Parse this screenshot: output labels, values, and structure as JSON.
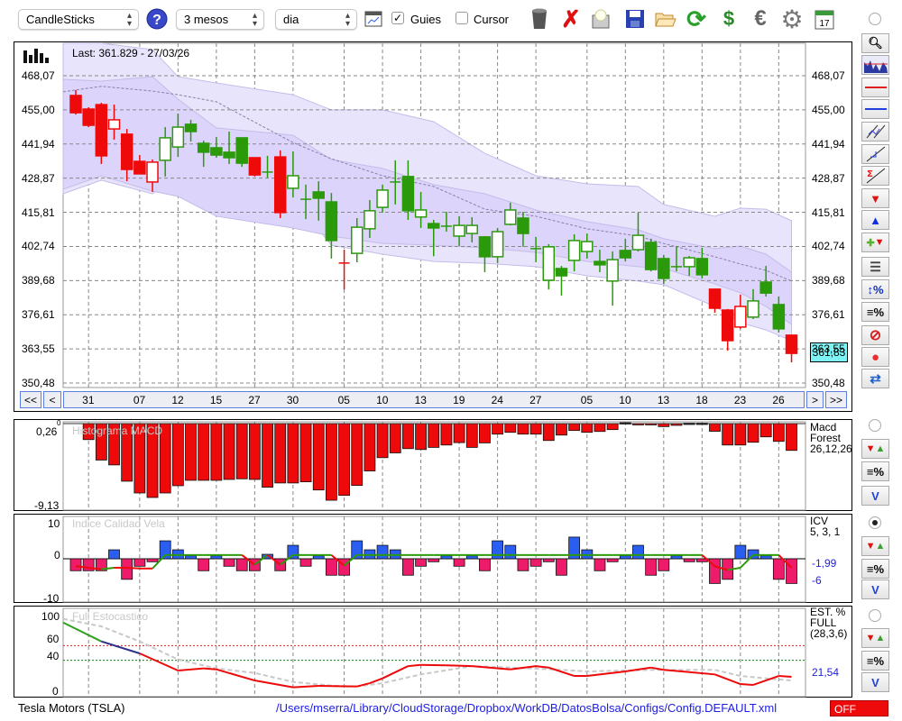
{
  "toolbar": {
    "chart_type": "CandleSticks",
    "period": "3 mesos",
    "interval": "dia",
    "guides_label": "Guies",
    "guides_checked": true,
    "cursor_label": "Cursor",
    "cursor_checked": false,
    "icons": [
      "help-icon",
      "chart-window-icon",
      "trash-icon",
      "delete-icon",
      "print-icon",
      "save-icon",
      "open-folder-icon",
      "refresh-icon",
      "download-icon",
      "euro-icon",
      "gear-icon",
      "calendar-icon"
    ],
    "calendar_day": "17"
  },
  "main_chart": {
    "last_label": "Last: 361.829 - 27/03/26",
    "last_price_box": "361,83",
    "price_ticks": [
      468.07,
      455.0,
      441.94,
      428.87,
      415.81,
      402.74,
      389.68,
      376.61,
      363.55,
      350.48
    ],
    "price_tick_labels": [
      "468,07",
      "455,00",
      "441,94",
      "428,87",
      "415,81",
      "402,74",
      "389,68",
      "376,61",
      "363,55",
      "350,48"
    ],
    "x_labels": [
      "31",
      "07",
      "12",
      "15",
      "27",
      "30",
      "05",
      "10",
      "13",
      "19",
      "24",
      "27",
      "05",
      "10",
      "13",
      "18",
      "23",
      "26"
    ],
    "x_label_candle_index": [
      1,
      5,
      8,
      11,
      14,
      17,
      21,
      24,
      27,
      30,
      33,
      36,
      40,
      43,
      46,
      49,
      52,
      55
    ],
    "nav": {
      "first": "<<",
      "prev": "<",
      "next": ">",
      "last": ">>"
    },
    "colors": {
      "up": "#2a9a0a",
      "down": "#ee0a0a",
      "band_outer": "#e8e4fc",
      "band_inner": "#dcd4fa",
      "cursor_box": "#7ff4f4"
    },
    "candles_ohlc": [
      [
        460.5,
        462.6,
        453.2,
        453.9,
        "r"
      ],
      [
        455.3,
        456.0,
        448.4,
        449.1,
        "r"
      ],
      [
        457.0,
        457.7,
        434.3,
        437.4,
        "r"
      ],
      [
        447.7,
        457.0,
        443.6,
        451.2,
        "r"
      ],
      [
        445.7,
        447.7,
        427.7,
        432.2,
        "r"
      ],
      [
        435.3,
        437.7,
        430.5,
        430.5,
        "r"
      ],
      [
        427.4,
        436.0,
        423.6,
        435.0,
        "r"
      ],
      [
        435.7,
        448.4,
        429.5,
        444.3,
        "g"
      ],
      [
        440.8,
        453.6,
        437.0,
        448.4,
        "g"
      ],
      [
        449.5,
        451.2,
        442.9,
        446.7,
        "g"
      ],
      [
        442.2,
        443.2,
        433.2,
        438.8,
        "g"
      ],
      [
        440.5,
        444.6,
        436.7,
        437.7,
        "g"
      ],
      [
        438.8,
        446.7,
        434.3,
        436.7,
        "g"
      ],
      [
        444.3,
        444.3,
        433.2,
        434.6,
        "g"
      ],
      [
        436.7,
        436.7,
        429.5,
        430.1,
        "r"
      ],
      [
        431.2,
        437.4,
        429.0,
        431.2,
        "g"
      ],
      [
        437.0,
        439.5,
        413.6,
        415.7,
        "r"
      ],
      [
        425.0,
        439.1,
        421.5,
        429.8,
        "g"
      ],
      [
        420.8,
        426.4,
        413.2,
        420.8,
        "g"
      ],
      [
        423.6,
        427.7,
        412.6,
        421.2,
        "g"
      ],
      [
        419.8,
        423.2,
        398.1,
        405.0,
        "g"
      ],
      [
        396.4,
        401.5,
        386.3,
        396.4,
        "r"
      ],
      [
        400.1,
        413.6,
        396.7,
        410.1,
        "g"
      ],
      [
        409.5,
        420.5,
        406.0,
        416.4,
        "g"
      ],
      [
        417.7,
        426.4,
        415.7,
        424.3,
        "g"
      ],
      [
        427.4,
        435.7,
        418.8,
        427.4,
        "g"
      ],
      [
        429.5,
        435.7,
        412.9,
        416.4,
        "g"
      ],
      [
        414.0,
        423.6,
        409.8,
        416.7,
        "g"
      ],
      [
        411.5,
        412.9,
        399.0,
        409.8,
        "g"
      ],
      [
        410.5,
        416.0,
        408.4,
        410.5,
        "g"
      ],
      [
        406.7,
        414.3,
        402.9,
        410.8,
        "g"
      ],
      [
        407.7,
        413.9,
        404.3,
        410.8,
        "g"
      ],
      [
        406.4,
        406.7,
        392.9,
        398.8,
        "g"
      ],
      [
        398.8,
        409.8,
        396.4,
        408.4,
        "g"
      ],
      [
        411.2,
        419.5,
        410.8,
        416.7,
        "g"
      ],
      [
        413.6,
        416.0,
        402.6,
        407.7,
        "g"
      ],
      [
        401.9,
        406.4,
        396.7,
        401.9,
        "g"
      ],
      [
        389.8,
        403.6,
        386.3,
        402.6,
        "g"
      ],
      [
        394.3,
        395.3,
        383.9,
        391.5,
        "g"
      ],
      [
        397.4,
        407.4,
        393.2,
        405.0,
        "g"
      ],
      [
        400.8,
        407.7,
        398.1,
        404.6,
        "g"
      ],
      [
        397.0,
        401.5,
        392.9,
        395.7,
        "g"
      ],
      [
        389.5,
        400.8,
        380.1,
        397.7,
        "g"
      ],
      [
        401.2,
        405.7,
        397.0,
        398.4,
        "g"
      ],
      [
        401.5,
        415.7,
        400.8,
        407.0,
        "g"
      ],
      [
        404.3,
        405.7,
        393.2,
        393.9,
        "g"
      ],
      [
        398.1,
        399.5,
        388.4,
        390.5,
        "g"
      ],
      [
        395.0,
        402.9,
        393.2,
        395.0,
        "g"
      ],
      [
        395.0,
        399.1,
        391.5,
        398.4,
        "g"
      ],
      [
        398.1,
        402.2,
        390.5,
        391.9,
        "g"
      ],
      [
        386.4,
        386.4,
        377.4,
        379.1,
        "r"
      ],
      [
        378.4,
        378.8,
        362.9,
        366.7,
        "r"
      ],
      [
        371.9,
        384.3,
        371.2,
        379.8,
        "r"
      ],
      [
        375.7,
        386.4,
        375.0,
        381.9,
        "g"
      ],
      [
        389.1,
        395.3,
        383.6,
        384.9,
        "g"
      ],
      [
        380.5,
        383.6,
        369.8,
        371.2,
        "g"
      ],
      [
        368.8,
        368.8,
        358.4,
        361.83,
        "r"
      ]
    ],
    "bands": {
      "candle_index": [
        -1,
        2,
        6,
        8,
        11,
        17,
        20,
        24,
        28,
        32,
        36,
        40,
        44,
        46,
        50,
        52,
        54,
        56
      ],
      "outer_upper": [
        480.5,
        480.5,
        478.1,
        467.7,
        465.3,
        460.8,
        455.0,
        455.0,
        450.5,
        438.4,
        429.8,
        426.7,
        425.7,
        418.8,
        414.3,
        417.4,
        417.0,
        412.6
      ],
      "inner_upper": [
        466.7,
        466.0,
        467.7,
        459.1,
        448.1,
        445.3,
        436.0,
        432.6,
        426.4,
        422.9,
        416.7,
        412.2,
        409.1,
        405.7,
        401.9,
        402.9,
        399.8,
        392.9
      ],
      "middle": [
        461.9,
        464.0,
        462.2,
        460.8,
        458.1,
        442.5,
        436.3,
        429.8,
        425.7,
        417.0,
        414.3,
        409.5,
        406.7,
        403.9,
        398.8,
        396.0,
        393.6,
        389.5
      ],
      "inner_lower": [
        424.6,
        429.8,
        423.9,
        421.9,
        414.3,
        409.8,
        406.7,
        403.9,
        403.2,
        402.2,
        400.5,
        397.0,
        395.0,
        394.3,
        388.4,
        385.0,
        379.8,
        372.9
      ],
      "outer_lower": [
        422.9,
        428.1,
        422.9,
        429.8,
        431.5,
        421.2,
        403.2,
        399.8,
        397.0,
        396.3,
        395.0,
        391.5,
        389.5,
        388.1,
        379.8,
        373.6,
        370.8,
        366.7
      ]
    }
  },
  "macd": {
    "title": "Histograma MACD",
    "zero_label": "0",
    "max_label": "0,26",
    "min_label": "-9,13",
    "legend": [
      "Macd",
      "Forest",
      "26,12,26"
    ],
    "first_candle_index": 1,
    "values": [
      -1.81,
      -4.12,
      -4.67,
      -6.51,
      -7.84,
      -8.35,
      -7.84,
      -7.02,
      -6.41,
      -6.41,
      -6.41,
      -6.31,
      -6.24,
      -6.31,
      -7.19,
      -6.71,
      -6.71,
      -6.58,
      -7.5,
      -8.66,
      -8.11,
      -6.99,
      -5.35,
      -3.85,
      -3.31,
      -2.83,
      -2.93,
      -2.69,
      -2.42,
      -2.15,
      -2.69,
      -2.18,
      -1.19,
      -0.99,
      -1.19,
      -1.19,
      -1.91,
      -1.3,
      -0.78,
      -0.99,
      -0.89,
      -0.68,
      0.1,
      -0.1,
      -0.05,
      -0.34,
      -0.2,
      0.05,
      0.05,
      -0.87,
      -2.42,
      -2.42,
      -2.11,
      -1.5,
      -2.01,
      -3.03
    ]
  },
  "icv": {
    "title": "Indice Calidad Vela",
    "axis_labels": [
      "10",
      "0",
      "-10"
    ],
    "legend": [
      "ICV",
      "5, 3, 1"
    ],
    "value_labels": [
      "-1,99",
      "-6"
    ],
    "values": [
      -3.2,
      -3.2,
      -3.2,
      2.4,
      -5.5,
      -2.0,
      -0.8,
      4.8,
      2.4,
      0.8,
      -3.2,
      0.8,
      -2.0,
      -3.2,
      -3.2,
      1.2,
      -3.2,
      3.6,
      -2.0,
      0.8,
      -4.4,
      -4.4,
      4.8,
      2.4,
      3.6,
      2.4,
      -4.4,
      -2.0,
      -0.8,
      0.8,
      -2.0,
      0.8,
      -3.2,
      4.8,
      3.6,
      -3.2,
      -2.0,
      -0.8,
      -4.4,
      5.8,
      2.4,
      -3.2,
      -0.8,
      0.8,
      3.6,
      -4.4,
      -3.2,
      0.8,
      -0.8,
      -0.8,
      -6.6,
      -5.5,
      3.6,
      2.4,
      0.8,
      -5.5,
      -6.6
    ],
    "signal": [
      -2.0,
      -2.4,
      -2.8,
      -2.4,
      -2.4,
      -2.6,
      -2.6,
      1.0,
      1.0,
      1.0,
      1.0,
      1.0,
      1.0,
      1.0,
      -1.6,
      1.0,
      -1.6,
      1.0,
      1.0,
      1.0,
      1.0,
      -1.8,
      1.0,
      1.0,
      1.0,
      1.0,
      1.0,
      1.0,
      1.0,
      1.0,
      1.0,
      1.0,
      1.0,
      1.0,
      1.0,
      1.0,
      1.0,
      1.0,
      1.0,
      1.0,
      1.0,
      1.0,
      1.0,
      1.0,
      1.0,
      1.0,
      1.0,
      1.0,
      1.0,
      1.0,
      -2.0,
      -3.0,
      -2.4,
      1.0,
      1.0,
      1.0,
      -2.4
    ],
    "colors": {
      "pos": "#2a5ef0",
      "neg": "#ee1a6a",
      "up": "#2a9a0a",
      "down": "#ee0a0a"
    }
  },
  "stochastic": {
    "title": "Full Estocastico",
    "axis_labels": [
      "100",
      "60",
      "40",
      "0"
    ],
    "levels": [
      60,
      40
    ],
    "legend": [
      "EST. %",
      "FULL",
      "(28,3,6)"
    ],
    "value_label": "21,54",
    "main_index": [
      -1,
      2,
      5,
      8,
      10,
      11,
      14,
      17,
      19,
      22,
      23,
      24,
      26,
      27,
      29,
      31,
      34,
      36,
      37,
      39,
      40,
      43,
      45,
      46,
      48,
      50,
      52,
      53,
      55,
      56
    ],
    "main": [
      91.7,
      65.8,
      49.4,
      25.9,
      28.8,
      27.5,
      12.3,
      2.9,
      4.9,
      4.1,
      8.6,
      15.2,
      32,
      33.7,
      33,
      32,
      27.5,
      32,
      30,
      18.5,
      18.5,
      24.7,
      30,
      26.8,
      23.8,
      20.6,
      7.4,
      6.2,
      18.5,
      17.3
    ],
    "signal_index": [
      -1,
      2,
      5,
      8,
      11,
      14,
      17,
      20,
      22,
      24,
      27,
      31,
      34,
      38,
      40,
      45,
      50,
      52,
      54,
      56
    ],
    "signal": [
      96.7,
      86.4,
      65.8,
      41.1,
      28.8,
      22.6,
      10.3,
      5.3,
      4.1,
      8.6,
      20.6,
      32,
      30,
      26.8,
      24.7,
      26.8,
      26.8,
      18.5,
      15.2,
      12.3
    ]
  },
  "footer": {
    "ticker": "Tesla Motors (TSLA)",
    "config_path": "/Users/mserra/Library/CloudStorage/Dropbox/WorkDB/DatosBolsa/Configs/Config.DEFAULT.xml",
    "status": "OFF"
  }
}
